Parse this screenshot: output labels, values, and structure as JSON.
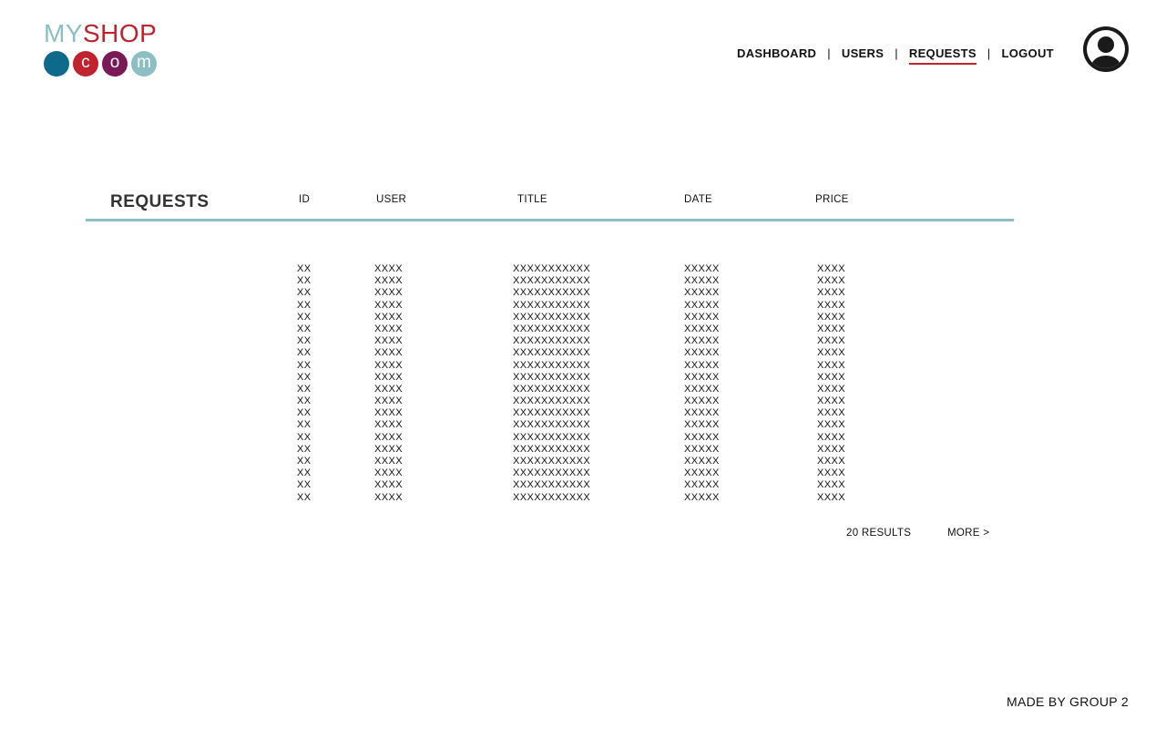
{
  "logo": {
    "part1": "MY",
    "part2": "SHOP",
    "dots": [
      {
        "letter": "",
        "color": "#0e6a8a"
      },
      {
        "letter": "c",
        "color": "#c0222e"
      },
      {
        "letter": "o",
        "color": "#7a1a57"
      },
      {
        "letter": "m",
        "color": "#8bbfc4"
      }
    ]
  },
  "nav": {
    "items": [
      {
        "label": "DASHBOARD",
        "active": false
      },
      {
        "label": "USERS",
        "active": false
      },
      {
        "label": "REQUESTS",
        "active": true
      },
      {
        "label": "LOGOUT",
        "active": false
      }
    ],
    "separator": "|"
  },
  "avatar": {
    "icon": "user-avatar-icon"
  },
  "colors": {
    "accent_teal": "#8bbfc4",
    "accent_red": "#c0222e"
  },
  "requests": {
    "title": "REQUESTS",
    "columns": [
      "ID",
      "USER",
      "TITLE",
      "DATE",
      "PRICE"
    ],
    "rows": [
      [
        "XX",
        "XXXX",
        "XXXXXXXXXXX",
        "XXXXX",
        "XXXX"
      ],
      [
        "XX",
        "XXXX",
        "XXXXXXXXXXX",
        "XXXXX",
        "XXXX"
      ],
      [
        "XX",
        "XXXX",
        "XXXXXXXXXXX",
        "XXXXX",
        "XXXX"
      ],
      [
        "XX",
        "XXXX",
        "XXXXXXXXXXX",
        "XXXXX",
        "XXXX"
      ],
      [
        "XX",
        "XXXX",
        "XXXXXXXXXXX",
        "XXXXX",
        "XXXX"
      ],
      [
        "XX",
        "XXXX",
        "XXXXXXXXXXX",
        "XXXXX",
        "XXXX"
      ],
      [
        "XX",
        "XXXX",
        "XXXXXXXXXXX",
        "XXXXX",
        "XXXX"
      ],
      [
        "XX",
        "XXXX",
        "XXXXXXXXXXX",
        "XXXXX",
        "XXXX"
      ],
      [
        "XX",
        "XXXX",
        "XXXXXXXXXXX",
        "XXXXX",
        "XXXX"
      ],
      [
        "XX",
        "XXXX",
        "XXXXXXXXXXX",
        "XXXXX",
        "XXXX"
      ],
      [
        "XX",
        "XXXX",
        "XXXXXXXXXXX",
        "XXXXX",
        "XXXX"
      ],
      [
        "XX",
        "XXXX",
        "XXXXXXXXXXX",
        "XXXXX",
        "XXXX"
      ],
      [
        "XX",
        "XXXX",
        "XXXXXXXXXXX",
        "XXXXX",
        "XXXX"
      ],
      [
        "XX",
        "XXXX",
        "XXXXXXXXXXX",
        "XXXXX",
        "XXXX"
      ],
      [
        "XX",
        "XXXX",
        "XXXXXXXXXXX",
        "XXXXX",
        "XXXX"
      ],
      [
        "XX",
        "XXXX",
        "XXXXXXXXXXX",
        "XXXXX",
        "XXXX"
      ],
      [
        "XX",
        "XXXX",
        "XXXXXXXXXXX",
        "XXXXX",
        "XXXX"
      ],
      [
        "XX",
        "XXXX",
        "XXXXXXXXXXX",
        "XXXXX",
        "XXXX"
      ],
      [
        "XX",
        "XXXX",
        "XXXXXXXXXXX",
        "XXXXX",
        "XXXX"
      ],
      [
        "XX",
        "XXXX",
        "XXXXXXXXXXX",
        "XXXXX",
        "XXXX"
      ]
    ],
    "results_text": "20 RESULTS",
    "more_label": "MORE >"
  },
  "footer": {
    "credit": "MADE BY GROUP 2"
  }
}
